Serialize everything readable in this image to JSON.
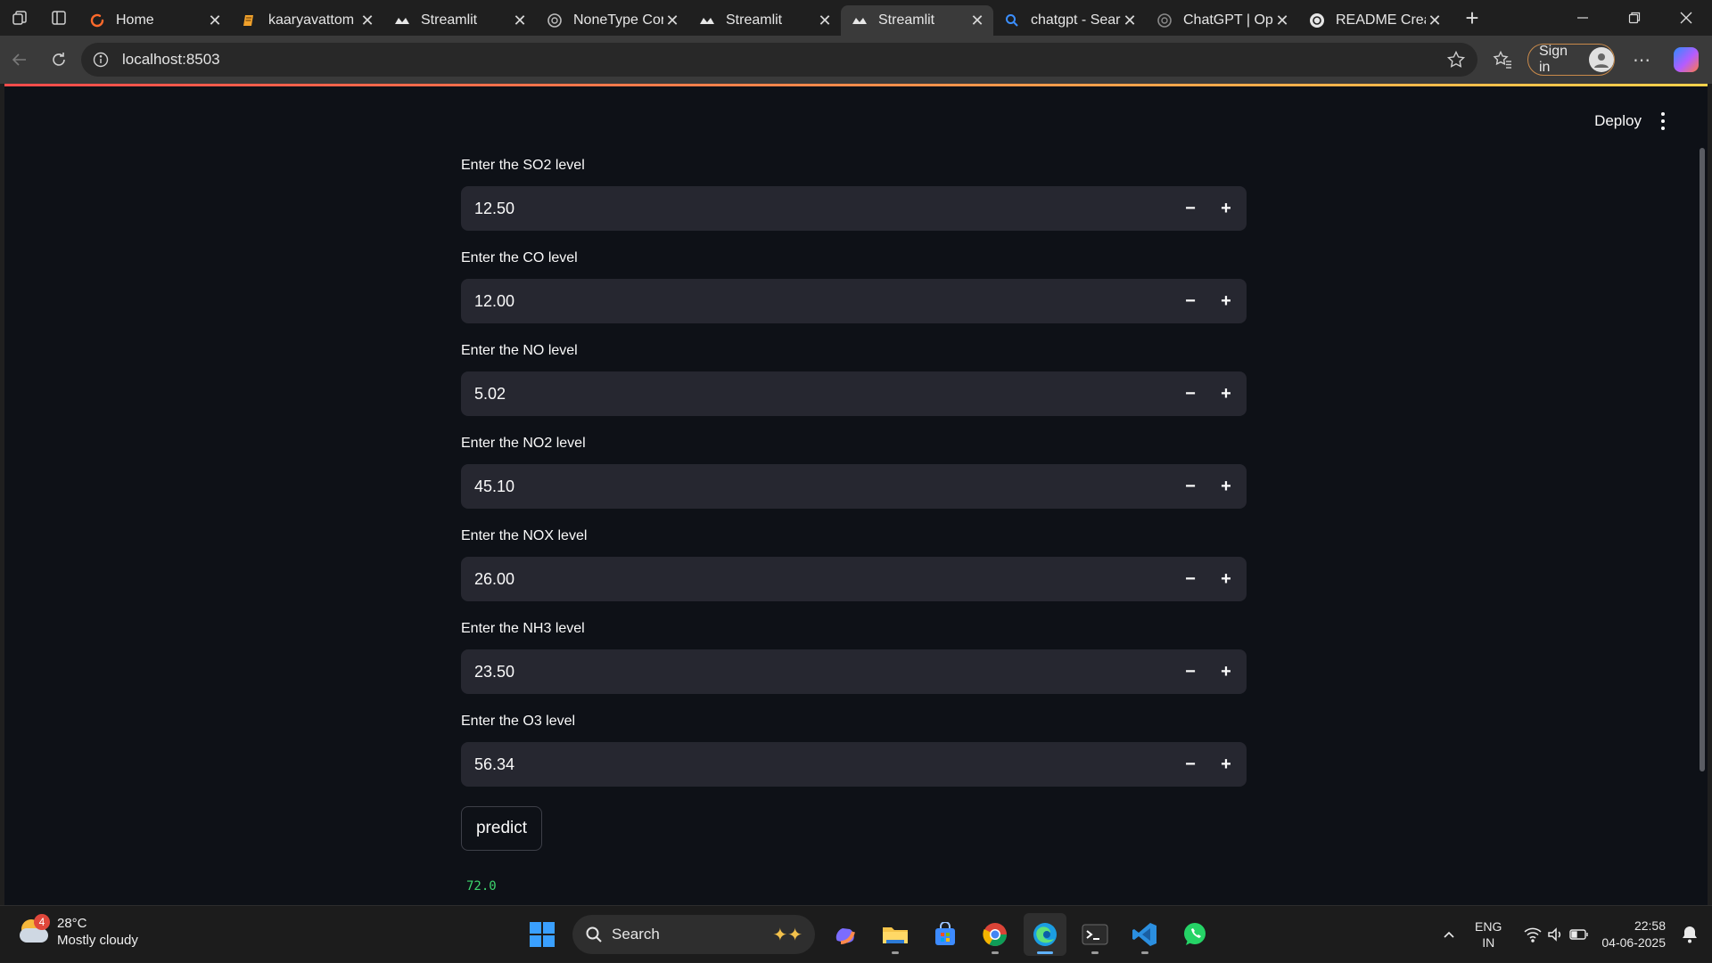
{
  "browser": {
    "tabs": [
      {
        "title": "Home",
        "favicon": "loading-ring-icon",
        "active": false
      },
      {
        "title": "kaaryavattom",
        "favicon": "book-icon",
        "active": false
      },
      {
        "title": "Streamlit",
        "favicon": "streamlit-crown-icon",
        "active": false
      },
      {
        "title": "NoneType Cor",
        "favicon": "openai-icon",
        "active": false
      },
      {
        "title": "Streamlit",
        "favicon": "streamlit-crown-icon",
        "active": false
      },
      {
        "title": "Streamlit",
        "favicon": "streamlit-crown-icon",
        "active": true
      },
      {
        "title": "chatgpt - Sear",
        "favicon": "search-icon",
        "active": false
      },
      {
        "title": "ChatGPT | Op",
        "favicon": "openai-icon",
        "active": false
      },
      {
        "title": "README Crea",
        "favicon": "openai-icon",
        "active": false
      }
    ],
    "url": "localhost:8503",
    "signin_label": "Sign in"
  },
  "app": {
    "deploy_label": "Deploy",
    "fields": [
      {
        "label": "Enter the SO2 level",
        "value": "12.50"
      },
      {
        "label": "Enter the CO level",
        "value": "12.00"
      },
      {
        "label": "Enter the NO level",
        "value": "5.02"
      },
      {
        "label": "Enter the NO2 level",
        "value": "45.10"
      },
      {
        "label": "Enter the NOX level",
        "value": "26.00"
      },
      {
        "label": "Enter the NH3 level",
        "value": "23.50"
      },
      {
        "label": "Enter the O3 level",
        "value": "56.34"
      }
    ],
    "predict_label": "predict",
    "result": "72.0",
    "colors": {
      "background": "#0e1117",
      "input": "#262730",
      "result": "#3dd56d",
      "accent": "#ff4b4b"
    }
  },
  "taskbar": {
    "weather": {
      "temp": "28°C",
      "condition": "Mostly cloudy",
      "badge": "4"
    },
    "search_placeholder": "Search",
    "language": {
      "line1": "ENG",
      "line2": "IN"
    },
    "time": "22:58",
    "date": "04-06-2025"
  }
}
